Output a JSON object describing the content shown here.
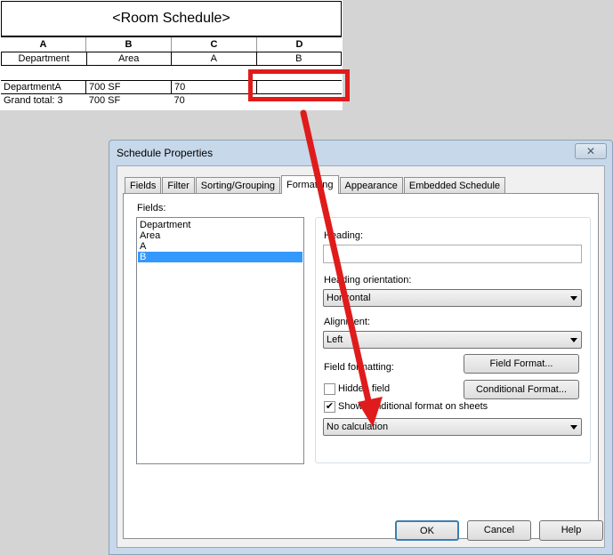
{
  "schedule": {
    "title": "<Room Schedule>",
    "column_letters": [
      "A",
      "B",
      "C",
      "D"
    ],
    "headers": [
      "Department",
      "Area",
      "A",
      "B"
    ],
    "rows": [
      [
        "DepartmentA",
        "700 SF",
        "70",
        ""
      ],
      [
        "Grand total: 3",
        "700 SF",
        "70",
        ""
      ]
    ]
  },
  "dialog": {
    "title": "Schedule Properties",
    "close_glyph": "✕",
    "tabs": [
      "Fields",
      "Filter",
      "Sorting/Grouping",
      "Formatting",
      "Appearance",
      "Embedded Schedule"
    ],
    "active_tab": "Formatting",
    "fields_label": "Fields:",
    "fields": [
      "Department",
      "Area",
      "A",
      "B"
    ],
    "selected_field": "B",
    "heading_label": "Heading:",
    "heading_value": "",
    "heading_orientation_label": "Heading orientation:",
    "heading_orientation_value": "Horizontal",
    "alignment_label": "Alignment:",
    "alignment_value": "Left",
    "field_formatting_label": "Field formatting:",
    "field_format_button": "Field Format...",
    "hidden_field_label": "Hidden field",
    "hidden_field_checked": false,
    "conditional_format_button": "Conditional  Format...",
    "show_conditional_label": "Show conditional format on sheets",
    "show_conditional_checked": true,
    "calculation_value": "No calculation",
    "ok_button": "OK",
    "cancel_button": "Cancel",
    "help_button": "Help"
  },
  "colors": {
    "annotation_red": "#e01b1b",
    "selection_blue": "#3399ff",
    "dialog_frame": "#c6d8ea"
  }
}
